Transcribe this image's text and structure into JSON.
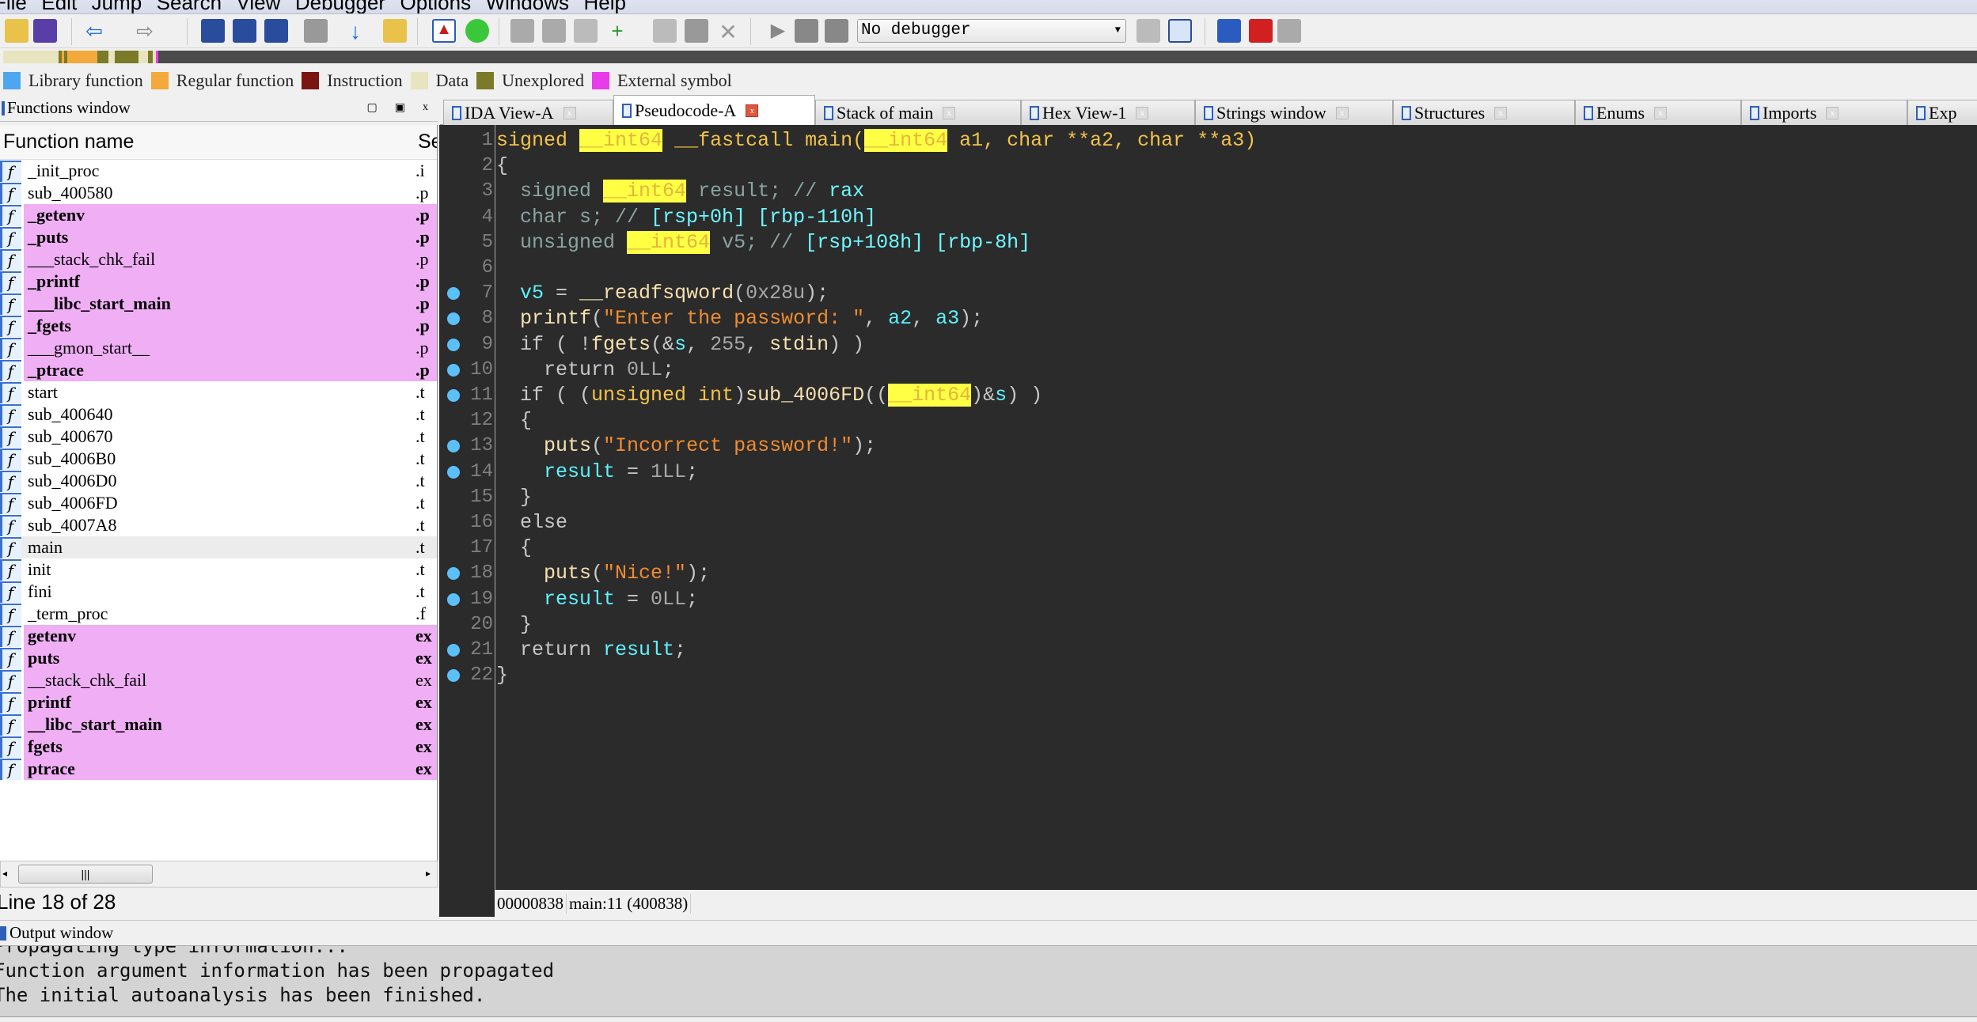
{
  "menu": [
    "File",
    "Edit",
    "Jump",
    "Search",
    "View",
    "Debugger",
    "Options",
    "Windows",
    "Help"
  ],
  "toolbar": {
    "debugger_select": "No debugger",
    "icons": [
      "open-icon",
      "save-icon",
      "back-icon",
      "forward-icon",
      "find-hex-icon",
      "find-text-icon",
      "find-binary-icon",
      "next-icon",
      "jump-down-icon",
      "analyze-icon",
      "abort-icon",
      "go-icon",
      "code-icon",
      "data-icon",
      "string-icon",
      "struct-icon",
      "undefine-icon",
      "edit-icon",
      "delete-icon",
      "run-icon",
      "pause-icon",
      "stop-icon"
    ]
  },
  "legend": [
    {
      "label": "Library function",
      "color": "#4ea6f0"
    },
    {
      "label": "Regular function",
      "color": "#f4a93c"
    },
    {
      "label": "Instruction",
      "color": "#7a1510"
    },
    {
      "label": "Data",
      "color": "#e8e4c0"
    },
    {
      "label": "Unexplored",
      "color": "#7a7a28"
    },
    {
      "label": "External symbol",
      "color": "#e83ce8"
    }
  ],
  "functions_window": {
    "title": "Functions window",
    "col_name": "Function name",
    "col_segment": "Se",
    "rows": [
      {
        "name": "_init_proc",
        "seg": ".i",
        "imp": false,
        "bold": false
      },
      {
        "name": "sub_400580",
        "seg": ".p",
        "imp": false,
        "bold": false
      },
      {
        "name": "_getenv",
        "seg": ".p",
        "imp": true,
        "bold": true
      },
      {
        "name": "_puts",
        "seg": ".p",
        "imp": true,
        "bold": true
      },
      {
        "name": "___stack_chk_fail",
        "seg": ".p",
        "imp": true,
        "bold": false
      },
      {
        "name": "_printf",
        "seg": ".p",
        "imp": true,
        "bold": true
      },
      {
        "name": "___libc_start_main",
        "seg": ".p",
        "imp": true,
        "bold": true
      },
      {
        "name": "_fgets",
        "seg": ".p",
        "imp": true,
        "bold": true
      },
      {
        "name": "___gmon_start__",
        "seg": ".p",
        "imp": true,
        "bold": false
      },
      {
        "name": "_ptrace",
        "seg": ".p",
        "imp": true,
        "bold": true
      },
      {
        "name": "start",
        "seg": ".t",
        "imp": false,
        "bold": false
      },
      {
        "name": "sub_400640",
        "seg": ".t",
        "imp": false,
        "bold": false
      },
      {
        "name": "sub_400670",
        "seg": ".t",
        "imp": false,
        "bold": false
      },
      {
        "name": "sub_4006B0",
        "seg": ".t",
        "imp": false,
        "bold": false
      },
      {
        "name": "sub_4006D0",
        "seg": ".t",
        "imp": false,
        "bold": false
      },
      {
        "name": "sub_4006FD",
        "seg": ".t",
        "imp": false,
        "bold": false
      },
      {
        "name": "sub_4007A8",
        "seg": ".t",
        "imp": false,
        "bold": false
      },
      {
        "name": "main",
        "seg": ".t",
        "imp": false,
        "bold": false,
        "selected": true
      },
      {
        "name": "init",
        "seg": ".t",
        "imp": false,
        "bold": false
      },
      {
        "name": "fini",
        "seg": ".t",
        "imp": false,
        "bold": false
      },
      {
        "name": "_term_proc",
        "seg": ".f",
        "imp": false,
        "bold": false
      },
      {
        "name": "getenv",
        "seg": "ex",
        "imp": true,
        "bold": true
      },
      {
        "name": "puts",
        "seg": "ex",
        "imp": true,
        "bold": true
      },
      {
        "name": "__stack_chk_fail",
        "seg": "ex",
        "imp": true,
        "bold": false
      },
      {
        "name": "printf",
        "seg": "ex",
        "imp": true,
        "bold": true
      },
      {
        "name": "__libc_start_main",
        "seg": "ex",
        "imp": true,
        "bold": true
      },
      {
        "name": "fgets",
        "seg": "ex",
        "imp": true,
        "bold": true
      },
      {
        "name": "ptrace",
        "seg": "ex",
        "imp": true,
        "bold": true
      }
    ],
    "status": "Line 18 of 28"
  },
  "tabs": [
    {
      "label": "IDA View-A",
      "active": false
    },
    {
      "label": "Pseudocode-A",
      "active": true
    },
    {
      "label": "Stack of main",
      "active": false
    },
    {
      "label": "Hex View-1",
      "active": false
    },
    {
      "label": "Strings window",
      "active": false
    },
    {
      "label": "Structures",
      "active": false
    },
    {
      "label": "Enums",
      "active": false
    },
    {
      "label": "Imports",
      "active": false
    },
    {
      "label": "Exp",
      "active": false
    }
  ],
  "code": [
    {
      "n": "1",
      "bp": false,
      "t": [
        [
          "signed ",
          "sig"
        ],
        [
          "__int64",
          "hl"
        ],
        [
          " __fastcall main(",
          "sig"
        ],
        [
          "__int64",
          "hl"
        ],
        [
          " a1, char **a2, char **a3)",
          "sig"
        ]
      ]
    },
    {
      "n": "2",
      "bp": false,
      "t": [
        [
          "{",
          "kw"
        ]
      ]
    },
    {
      "n": "3",
      "bp": false,
      "t": [
        [
          "  signed ",
          "decl"
        ],
        [
          "__int64",
          "hl"
        ],
        [
          " result; // ",
          "decl"
        ],
        [
          "rax",
          "cmt"
        ]
      ]
    },
    {
      "n": "4",
      "bp": false,
      "t": [
        [
          "  char s; // ",
          "decl"
        ],
        [
          "[rsp+0h] [rbp-110h]",
          "cmt"
        ]
      ]
    },
    {
      "n": "5",
      "bp": false,
      "t": [
        [
          "  unsigned ",
          "decl"
        ],
        [
          "__int64",
          "hl"
        ],
        [
          " v5; // ",
          "decl"
        ],
        [
          "[rsp+108h] [rbp-8h]",
          "cmt"
        ]
      ]
    },
    {
      "n": "6",
      "bp": false,
      "t": []
    },
    {
      "n": "7",
      "bp": true,
      "t": [
        [
          "  ",
          "kw"
        ],
        [
          "v5",
          "var"
        ],
        [
          " = ",
          "kw"
        ],
        [
          "__readfsqword",
          "fn"
        ],
        [
          "(",
          "kw"
        ],
        [
          "0x28u",
          "num"
        ],
        [
          ");",
          "kw"
        ]
      ]
    },
    {
      "n": "8",
      "bp": true,
      "t": [
        [
          "  ",
          "kw"
        ],
        [
          "printf",
          "fn"
        ],
        [
          "(",
          "kw"
        ],
        [
          "\"Enter the password: \"",
          "str"
        ],
        [
          ", ",
          "kw"
        ],
        [
          "a2",
          "var"
        ],
        [
          ", ",
          "kw"
        ],
        [
          "a3",
          "var"
        ],
        [
          ");",
          "kw"
        ]
      ]
    },
    {
      "n": "9",
      "bp": true,
      "t": [
        [
          "  if ( !",
          "kw"
        ],
        [
          "fgets",
          "fn"
        ],
        [
          "(&",
          "kw"
        ],
        [
          "s",
          "var"
        ],
        [
          ", ",
          "kw"
        ],
        [
          "255",
          "num"
        ],
        [
          ", ",
          "kw"
        ],
        [
          "stdin",
          "fn"
        ],
        [
          ") )",
          "kw"
        ]
      ]
    },
    {
      "n": "10",
      "bp": true,
      "t": [
        [
          "    return ",
          "kw"
        ],
        [
          "0LL",
          "num"
        ],
        [
          ";",
          "kw"
        ]
      ]
    },
    {
      "n": "11",
      "bp": true,
      "t": [
        [
          "  if ( (",
          "kw"
        ],
        [
          "unsigned int",
          "type"
        ],
        [
          ")",
          "kw"
        ],
        [
          "sub_4006FD",
          "fn"
        ],
        [
          "((",
          "kw"
        ],
        [
          "__int64",
          "hl"
        ],
        [
          ")&",
          "kw"
        ],
        [
          "s",
          "var"
        ],
        [
          ") )",
          "kw"
        ]
      ]
    },
    {
      "n": "12",
      "bp": false,
      "t": [
        [
          "  {",
          "kw"
        ]
      ]
    },
    {
      "n": "13",
      "bp": true,
      "t": [
        [
          "    ",
          "kw"
        ],
        [
          "puts",
          "fn"
        ],
        [
          "(",
          "kw"
        ],
        [
          "\"Incorrect password!\"",
          "str"
        ],
        [
          ");",
          "kw"
        ]
      ]
    },
    {
      "n": "14",
      "bp": true,
      "t": [
        [
          "    ",
          "kw"
        ],
        [
          "result",
          "var"
        ],
        [
          " = ",
          "kw"
        ],
        [
          "1LL",
          "num"
        ],
        [
          ";",
          "kw"
        ]
      ]
    },
    {
      "n": "15",
      "bp": false,
      "t": [
        [
          "  }",
          "kw"
        ]
      ]
    },
    {
      "n": "16",
      "bp": false,
      "t": [
        [
          "  else",
          "kw"
        ]
      ]
    },
    {
      "n": "17",
      "bp": false,
      "t": [
        [
          "  {",
          "kw"
        ]
      ]
    },
    {
      "n": "18",
      "bp": true,
      "t": [
        [
          "    ",
          "kw"
        ],
        [
          "puts",
          "fn"
        ],
        [
          "(",
          "kw"
        ],
        [
          "\"Nice!\"",
          "str"
        ],
        [
          ");",
          "kw"
        ]
      ]
    },
    {
      "n": "19",
      "bp": true,
      "t": [
        [
          "    ",
          "kw"
        ],
        [
          "result",
          "var"
        ],
        [
          " = ",
          "kw"
        ],
        [
          "0LL",
          "num"
        ],
        [
          ";",
          "kw"
        ]
      ]
    },
    {
      "n": "20",
      "bp": false,
      "t": [
        [
          "  }",
          "kw"
        ]
      ]
    },
    {
      "n": "21",
      "bp": true,
      "t": [
        [
          "  return ",
          "kw"
        ],
        [
          "result",
          "var"
        ],
        [
          ";",
          "kw"
        ]
      ]
    },
    {
      "n": "22",
      "bp": true,
      "t": [
        [
          "}",
          "kw"
        ]
      ]
    }
  ],
  "code_status": {
    "offset": "00000838",
    "location": "main:11 (400838)"
  },
  "output": {
    "title": "Output window",
    "lines": [
      "Propagating type information...",
      "Function argument information has been propagated",
      "The initial autoanalysis has been finished."
    ]
  }
}
